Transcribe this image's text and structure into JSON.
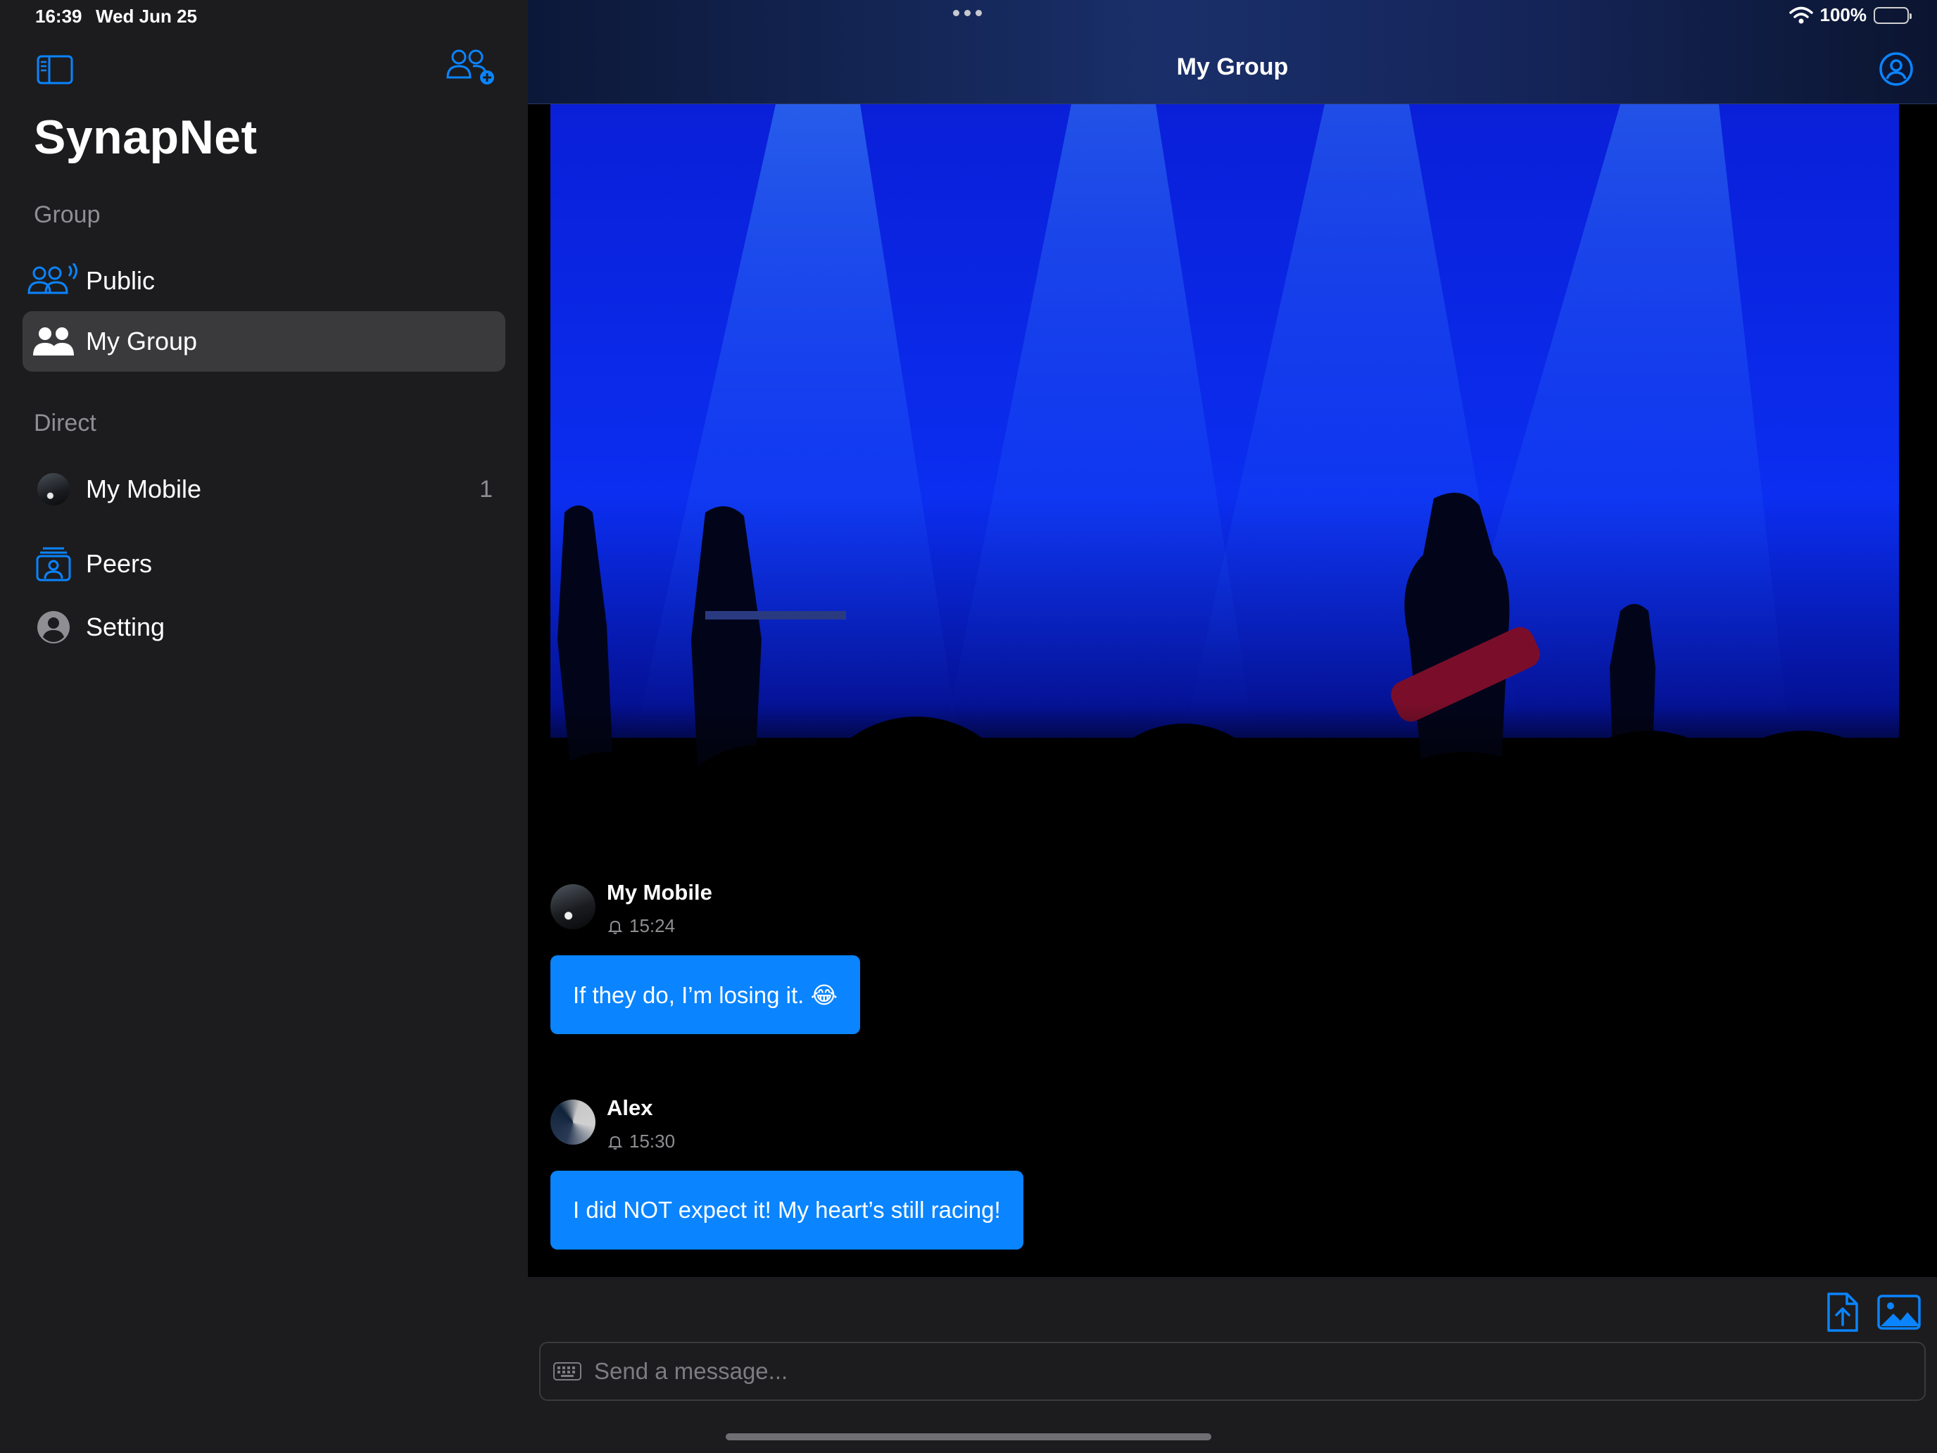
{
  "status_bar": {
    "time": "16:39",
    "date": "Wed Jun 25",
    "battery": "100%",
    "battery_level": 1.0
  },
  "sidebar": {
    "app_title": "SynapNet",
    "group_section_label": "Group",
    "direct_section_label": "Direct",
    "items": [
      {
        "label": "Public",
        "icon": "public-broadcast-icon"
      },
      {
        "label": "My Group",
        "icon": "group-icon",
        "selected": true
      },
      {
        "label": "My Mobile",
        "icon": "avatar",
        "badge": "1"
      },
      {
        "label": "Peers",
        "icon": "peers-icon"
      },
      {
        "label": "Setting",
        "icon": "person-circle-icon"
      }
    ],
    "toolbar_icons": [
      "sidebar-toggle-icon",
      "add-group-icon"
    ]
  },
  "chat": {
    "title": "My Group",
    "header_icon": "profile-icon",
    "messages": [
      {
        "sender": "My Mobile",
        "time": "15:24",
        "text": "If they do, I’m losing it. 😂"
      },
      {
        "sender": "Alex",
        "time": "15:30",
        "text": "I did NOT expect it! My heart’s still racing!"
      }
    ],
    "composer": {
      "placeholder": "Send a message...",
      "icons": [
        "attach-file-icon",
        "attach-image-icon",
        "keyboard-icon"
      ]
    }
  },
  "colors": {
    "accent": "#0a84ff",
    "sidebar_bg": "#1c1c1e",
    "selected_bg": "#3a3a3c",
    "secondary_text": "#8e8e93"
  }
}
